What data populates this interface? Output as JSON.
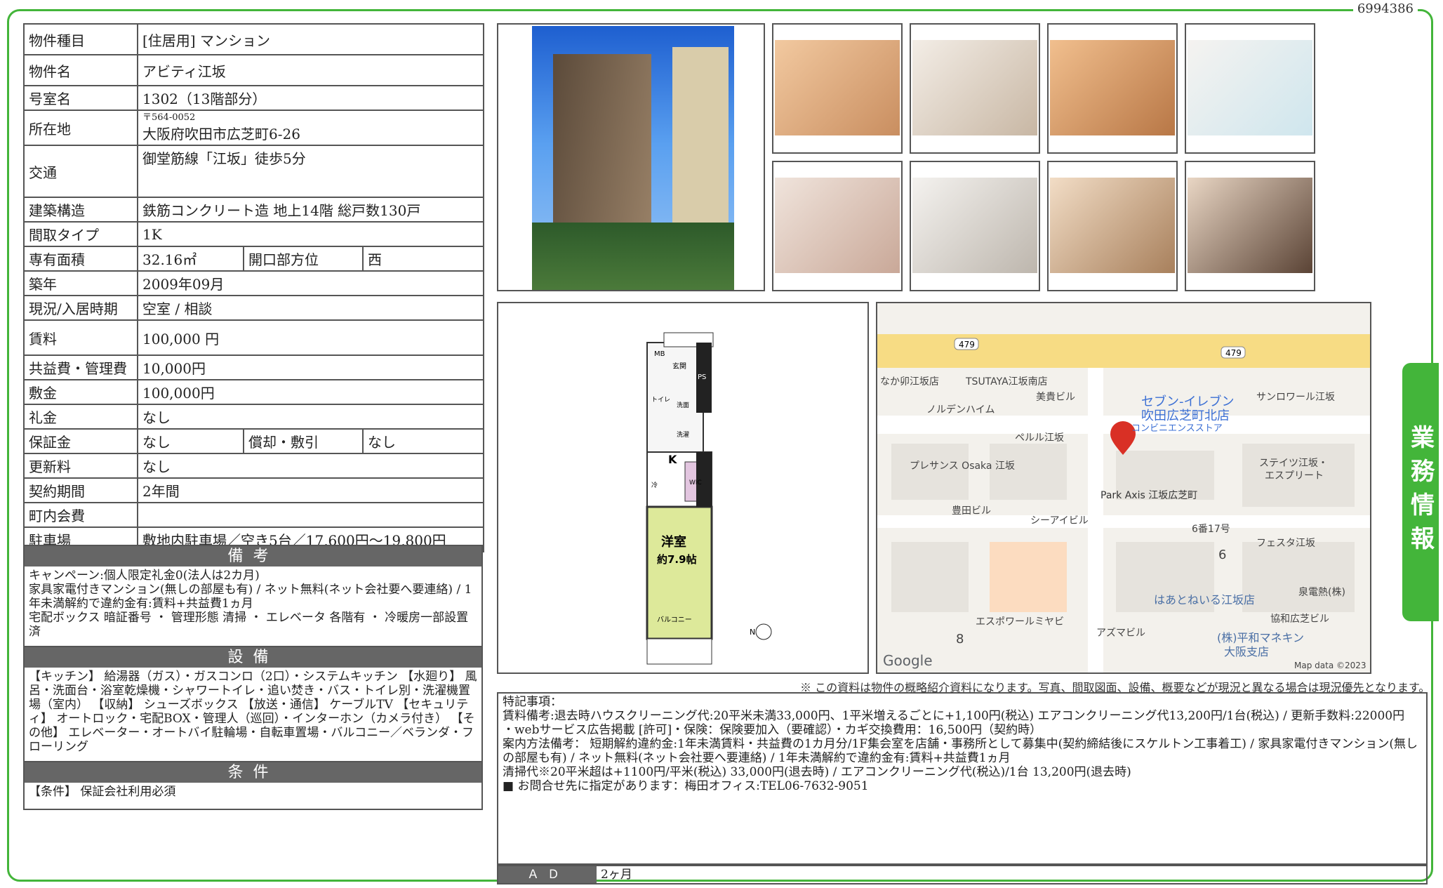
{
  "doc_id": "6994386",
  "side_tab": "業務情報",
  "rows": {
    "type_label": "物件種目",
    "type_value": "[住居用] マンション",
    "name_label": "物件名",
    "name_value": "アビティ江坂",
    "room_label": "号室名",
    "room_value": "1302（13階部分）",
    "addr_label": "所在地",
    "addr_zip": "〒564-0052",
    "addr_value": "大阪府吹田市広芝町6-26",
    "access_label": "交通",
    "access_value": "御堂筋線「江坂」徒歩5分",
    "struct_label": "建築構造",
    "struct_value": "鉄筋コンクリート造 地上14階 総戸数130戸",
    "layout_label": "間取タイプ",
    "layout_value": "1K",
    "area_label": "専有面積",
    "area_value": "32.16㎡",
    "dir_label": "開口部方位",
    "dir_value": "西",
    "built_label": "築年",
    "built_value": "2009年09月",
    "status_label": "現況/入居時期",
    "status_value": "空室 / 相談",
    "rent_label": "賃料",
    "rent_value": "100,000 円",
    "fee_label": "共益費・管理費",
    "fee_value": "10,000円",
    "deposit_label": "敷金",
    "deposit_value": "100,000円",
    "keymoney_label": "礼金",
    "keymoney_value": "なし",
    "guarantee_label": "保証金",
    "guarantee_value": "なし",
    "amort_label": "償却・敷引",
    "amort_value": "なし",
    "renew_label": "更新料",
    "renew_value": "なし",
    "term_label": "契約期間",
    "term_value": "2年間",
    "town_label": "町内会費",
    "town_value": "",
    "parking_label": "駐車場",
    "parking_value": "敷地内駐車場／空き5台／17,600円〜19,800円"
  },
  "biko": {
    "title": "備考",
    "text": "キャンペーン:個人限定礼金0(法人は2カ月)\n家具家電付きマンション(無しの部屋も有) / ネット無料(ネット会社要へ要連絡) / 1年未満解約で違約金有:賃料+共益費1ヵ月\n宅配ボックス 暗証番号 ・ 管理形態 清掃 ・ エレベータ 各階有 ・ 冷暖房一部設置済"
  },
  "setsubi": {
    "title": "設備",
    "text": "【キッチン】 給湯器（ガス）・ガスコンロ（2口）・システムキッチン 【水廻り】 風呂・洗面台・浴室乾燥機・シャワートイレ・追い焚き・バス・トイレ別・洗濯機置場（室内） 【収納】 シューズボックス 【放送・通信】 ケーブルTV 【セキュリティ】 オートロック・宅配BOX・管理人（巡回）・インターホン（カメラ付き） 【その他】 エレベーター・オートバイ駐輪場・自転車置場・バルコニー／ベランダ・フローリング"
  },
  "joken": {
    "title": "条件",
    "text": "【条件】 保証会社利用必須"
  },
  "floorplan": {
    "mb": "MB",
    "entrance": "玄関",
    "ps": "PS",
    "toilet": "トイレ",
    "wash": "洗面",
    "laundry": "洗濯",
    "k": "K",
    "fridge": "冷",
    "wic": "WIC",
    "room": "洋室",
    "room_size": "約7.9帖",
    "balcony": "バルコニー",
    "north": "N"
  },
  "map": {
    "route1": "479",
    "route2": "479",
    "labels": [
      "なか卯江坂店",
      "TSUTAYA江坂南店",
      "美貴ビル",
      "サンロワール江坂",
      "ノルデンハイム",
      "ペルル江坂",
      "ステイツ江坂・",
      "エスプリート",
      "プレサンス Osaka 江坂",
      "Park Axis 江坂広芝町",
      "豊田ビル",
      "シーアイビル",
      "6番17号",
      "フェスタ江坂",
      "泉電熱(株)",
      "はあとねいる江坂店",
      "エスポワールミヤビ",
      "アズマビル",
      "協和広芝ビル",
      "(株)平和マネキン",
      "大阪支店",
      "6",
      "8"
    ],
    "seven1": "セブン-イレブン",
    "seven2": "吹田広芝町北店",
    "seven3": "コンビニエンスストア",
    "google": "Google",
    "mapdata": "Map data ©2023"
  },
  "note": "※ この資料は物件の概略紹介資料になります。写真、間取図面、設備、概要などが現況と異なる場合は現況優先となります。",
  "remarks": "特記事項：\n賃料備考:退去時ハウスクリーニング代:20平米未満33,000円、1平米増えるごとに+1,100円(税込) エアコンクリーニング代13,200円/1台(税込) / 更新手数料:22000円\n・webサービス広告掲載 [許可]・保険：保険要加入（要確認）・カギ交換費用：16,500円（契約時）\n案内方法備考： 短期解約違約金:1年未満賃料・共益費の1カ月分/1F集会室を店舗・事務所として募集中(契約締結後にスケルトン工事着工) / 家具家電付きマンション(無しの部屋も有) / ネット無料(ネット会社要へ要連絡) / 1年未満解約で違約金有:賃料+共益費1ヵ月\n清掃代※20平米超は+1100円/平米(税込) 33,000円(退去時) / エアコンクリーニング代(税込)/1台 13,200円(退去時)\n■ お問合せ先に指定があります：梅田オフィス:TEL06-7632-9051",
  "ad_label": "ＡＤ",
  "ad_value": "2ヶ月"
}
